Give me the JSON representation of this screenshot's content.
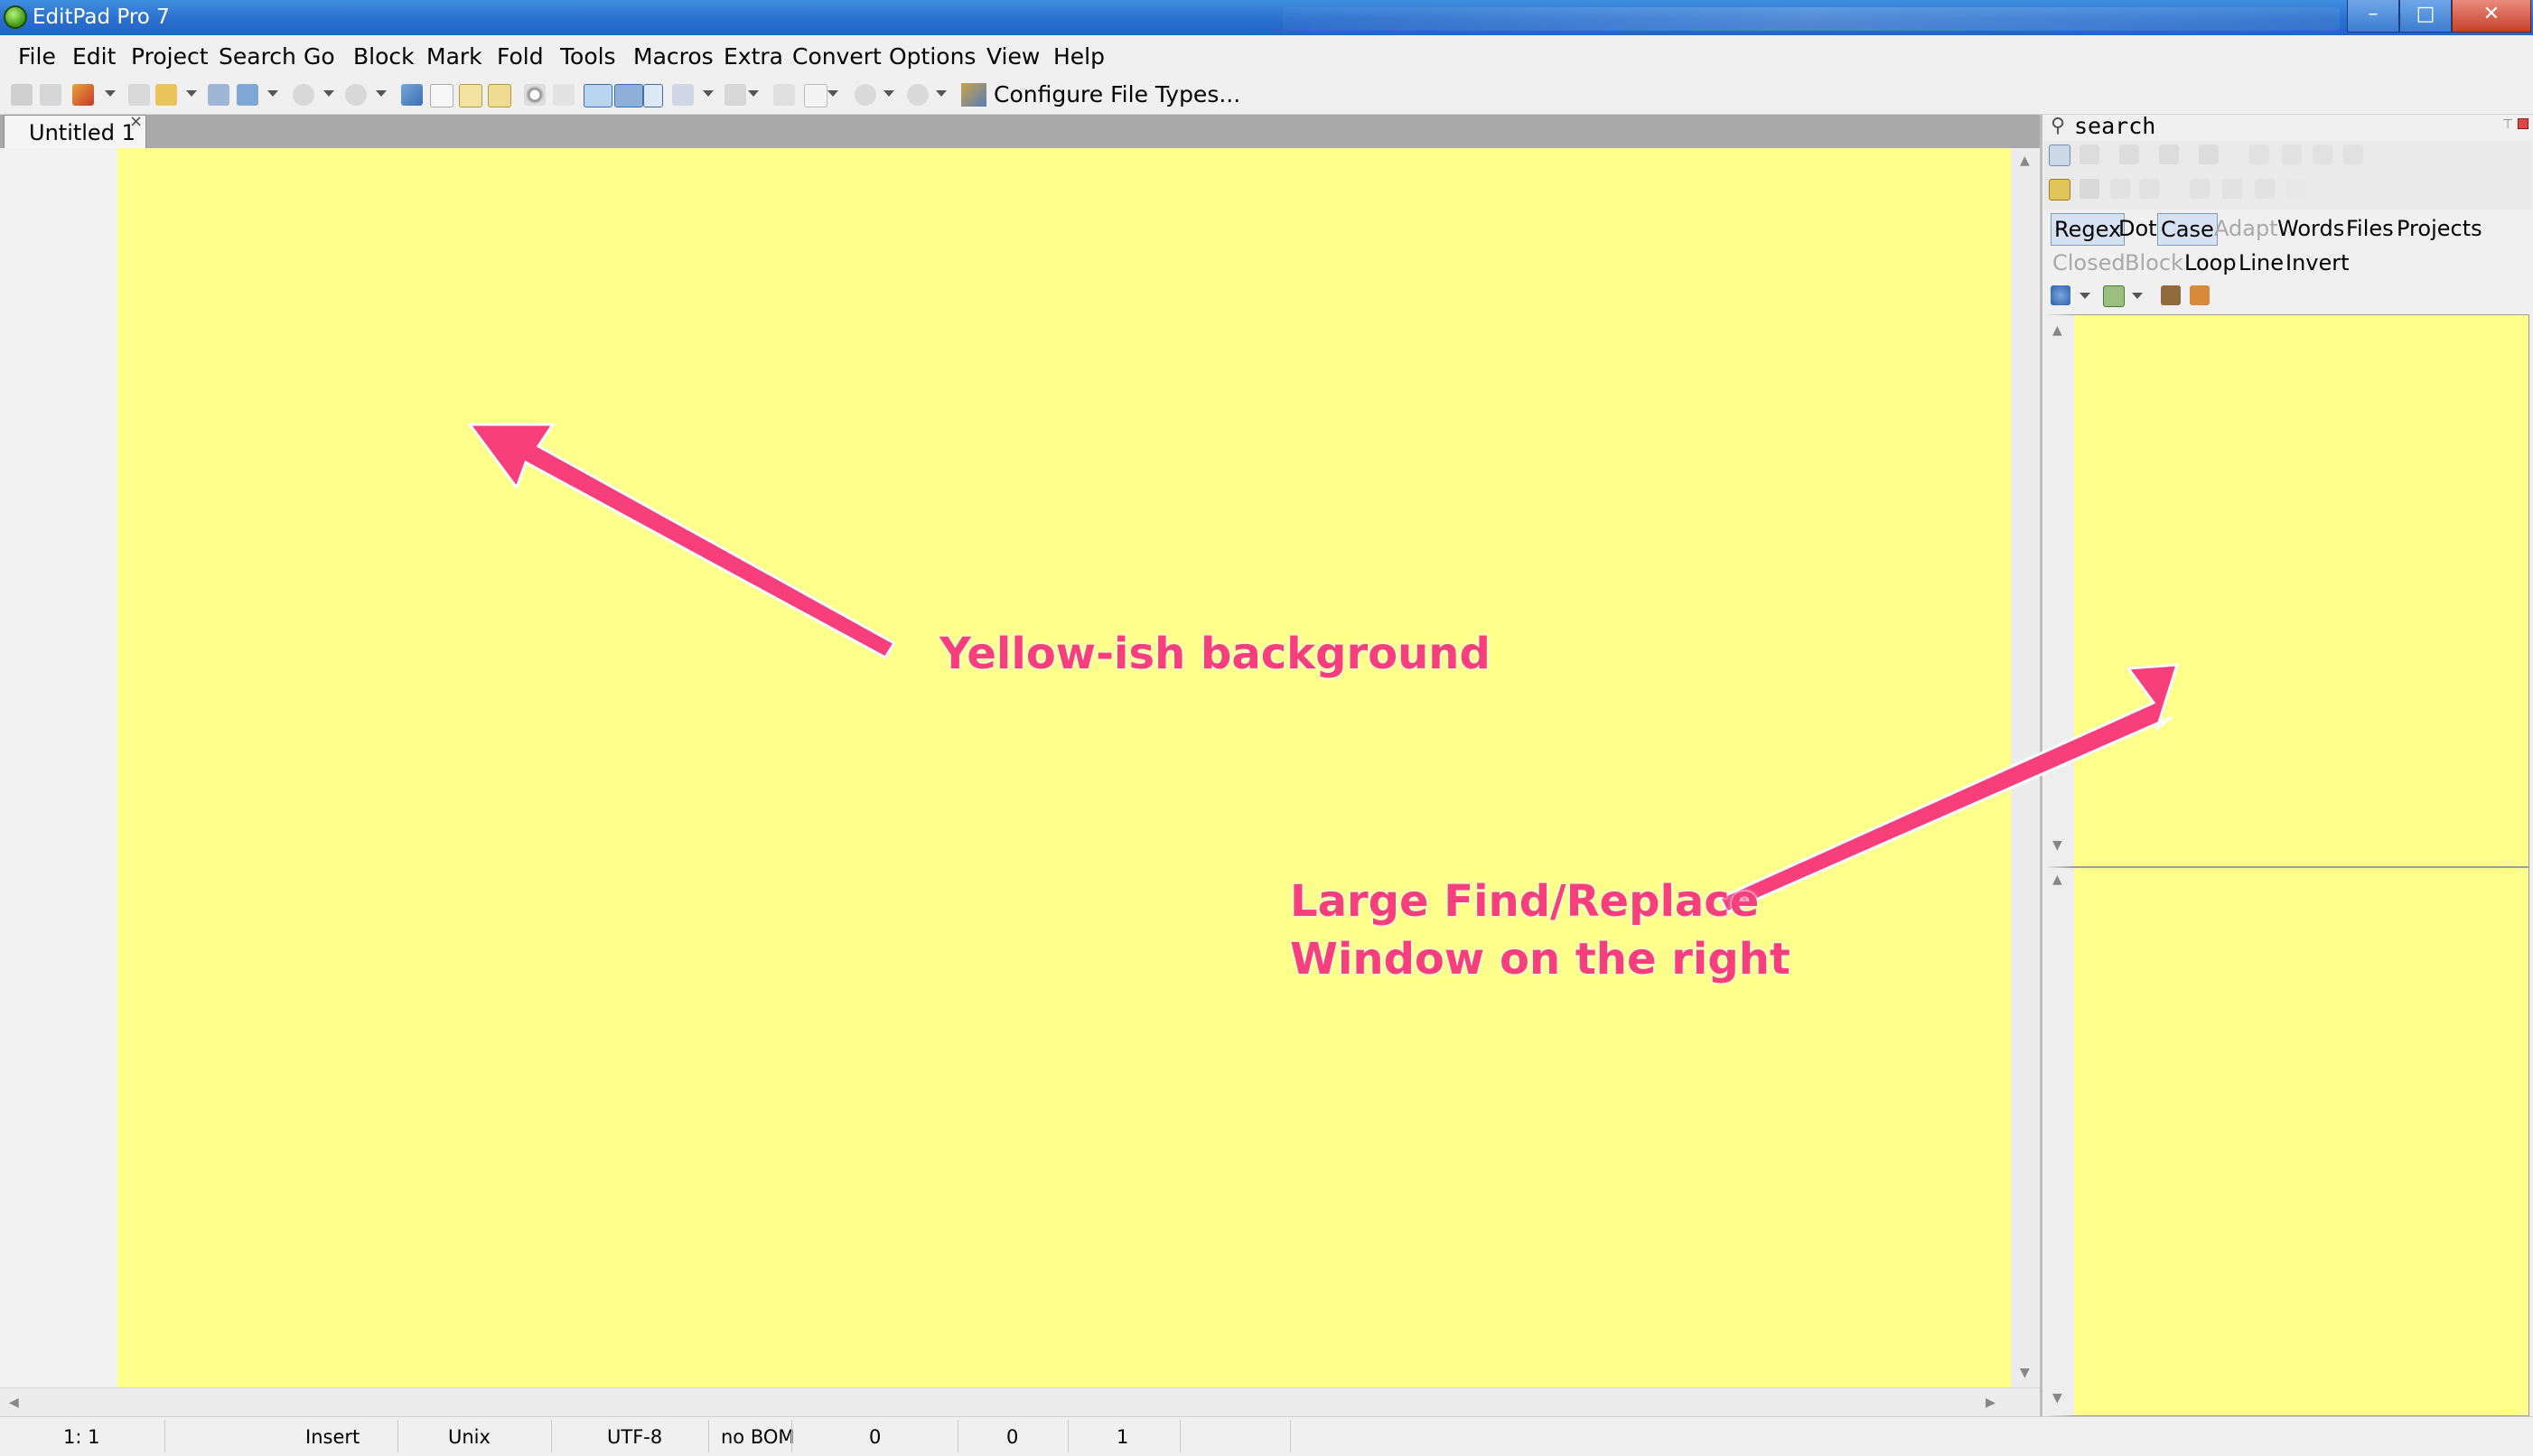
{
  "window": {
    "title": "EditPad Pro 7",
    "controls": {
      "minimize": "–",
      "maximize": "□",
      "close": "✕"
    }
  },
  "menu": [
    "File",
    "Edit",
    "Project",
    "Search",
    "Go",
    "Block",
    "Mark",
    "Fold",
    "Tools",
    "Macros",
    "Extra",
    "Convert",
    "Options",
    "View",
    "Help"
  ],
  "toolbar": {
    "configure_label": "Configure File Types..."
  },
  "tabs": [
    {
      "label": "Untitled 1",
      "close": "×"
    }
  ],
  "editor": {
    "background": "#ffff8c"
  },
  "search_panel": {
    "title": "search",
    "options_row1": [
      {
        "label": "Regex",
        "state": "on"
      },
      {
        "label": "Dot",
        "state": "off"
      },
      {
        "label": "Case",
        "state": "on"
      },
      {
        "label": "Adapt",
        "state": "disabled"
      },
      {
        "label": "Words",
        "state": "off"
      },
      {
        "label": "Files",
        "state": "off"
      },
      {
        "label": "Projects",
        "state": "off"
      }
    ],
    "options_row2": [
      {
        "label": "Closed",
        "state": "disabled"
      },
      {
        "label": "Block",
        "state": "disabled"
      },
      {
        "label": "Loop",
        "state": "off"
      },
      {
        "label": "Line",
        "state": "off"
      },
      {
        "label": "Invert",
        "state": "off"
      }
    ]
  },
  "status": {
    "position": "1: 1",
    "mode": "Insert",
    "line_breaks": "Unix",
    "encoding": "UTF-8",
    "bom": "no BOM",
    "count1": "0",
    "count2": "0",
    "count3": "1"
  },
  "annotations": {
    "editor_note": "Yellow-ish background",
    "panel_note_line1": "Large Find/Replace",
    "panel_note_line2": "Window on the right",
    "color": "#f73f7c"
  }
}
